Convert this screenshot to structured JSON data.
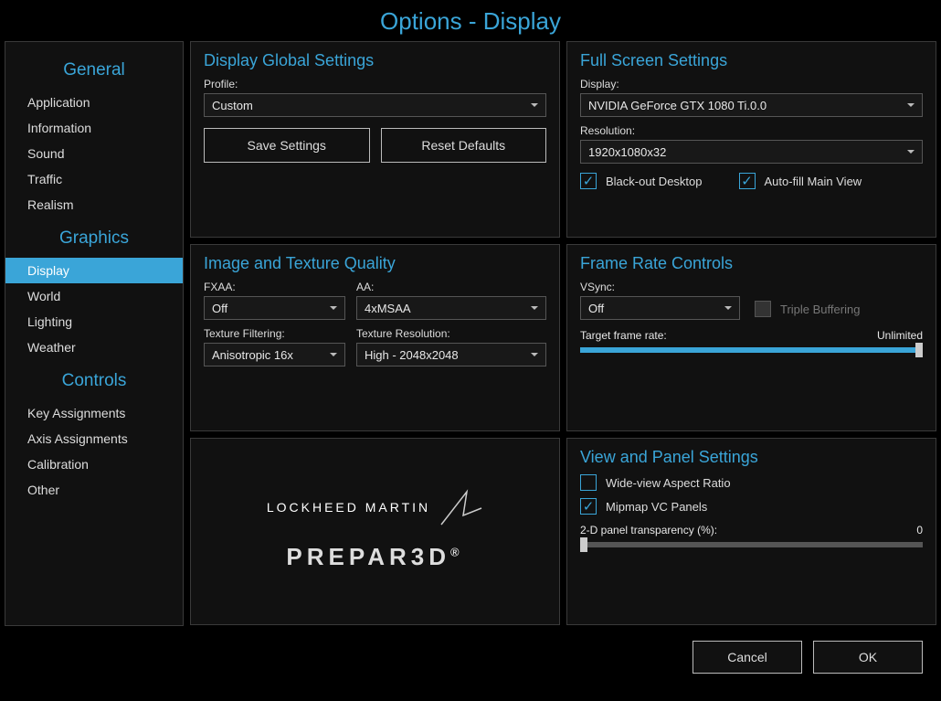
{
  "title": "Options - Display",
  "sidebar": {
    "groups": [
      {
        "title": "General",
        "items": [
          "Application",
          "Information",
          "Sound",
          "Traffic",
          "Realism"
        ]
      },
      {
        "title": "Graphics",
        "items": [
          "Display",
          "World",
          "Lighting",
          "Weather"
        ],
        "selected": "Display"
      },
      {
        "title": "Controls",
        "items": [
          "Key Assignments",
          "Axis Assignments",
          "Calibration",
          "Other"
        ]
      }
    ]
  },
  "displayGlobal": {
    "title": "Display Global Settings",
    "profile_label": "Profile:",
    "profile_value": "Custom",
    "save_label": "Save Settings",
    "reset_label": "Reset Defaults"
  },
  "fullscreen": {
    "title": "Full Screen Settings",
    "display_label": "Display:",
    "display_value": "NVIDIA GeForce GTX 1080 Ti.0.0",
    "resolution_label": "Resolution:",
    "resolution_value": "1920x1080x32",
    "blackout_label": "Black-out Desktop",
    "blackout_checked": true,
    "autofill_label": "Auto-fill Main View",
    "autofill_checked": true
  },
  "imageQuality": {
    "title": "Image and Texture Quality",
    "fxaa_label": "FXAA:",
    "fxaa_value": "Off",
    "aa_label": "AA:",
    "aa_value": "4xMSAA",
    "texfilter_label": "Texture Filtering:",
    "texfilter_value": "Anisotropic 16x",
    "texres_label": "Texture Resolution:",
    "texres_value": "High - 2048x2048"
  },
  "frameRate": {
    "title": "Frame Rate Controls",
    "vsync_label": "VSync:",
    "vsync_value": "Off",
    "triple_label": "Triple Buffering",
    "triple_enabled": false,
    "target_label": "Target frame rate:",
    "target_value": "Unlimited"
  },
  "logo": {
    "lm_text": "LOCKHEED MARTIN",
    "p3d_text": "PREPAR3D",
    "reg": "®"
  },
  "viewPanel": {
    "title": "View and Panel Settings",
    "wideview_label": "Wide-view Aspect Ratio",
    "wideview_checked": false,
    "mipmap_label": "Mipmap VC Panels",
    "mipmap_checked": true,
    "transparency_label": "2-D panel transparency (%):",
    "transparency_value": "0"
  },
  "footer": {
    "cancel": "Cancel",
    "ok": "OK"
  }
}
